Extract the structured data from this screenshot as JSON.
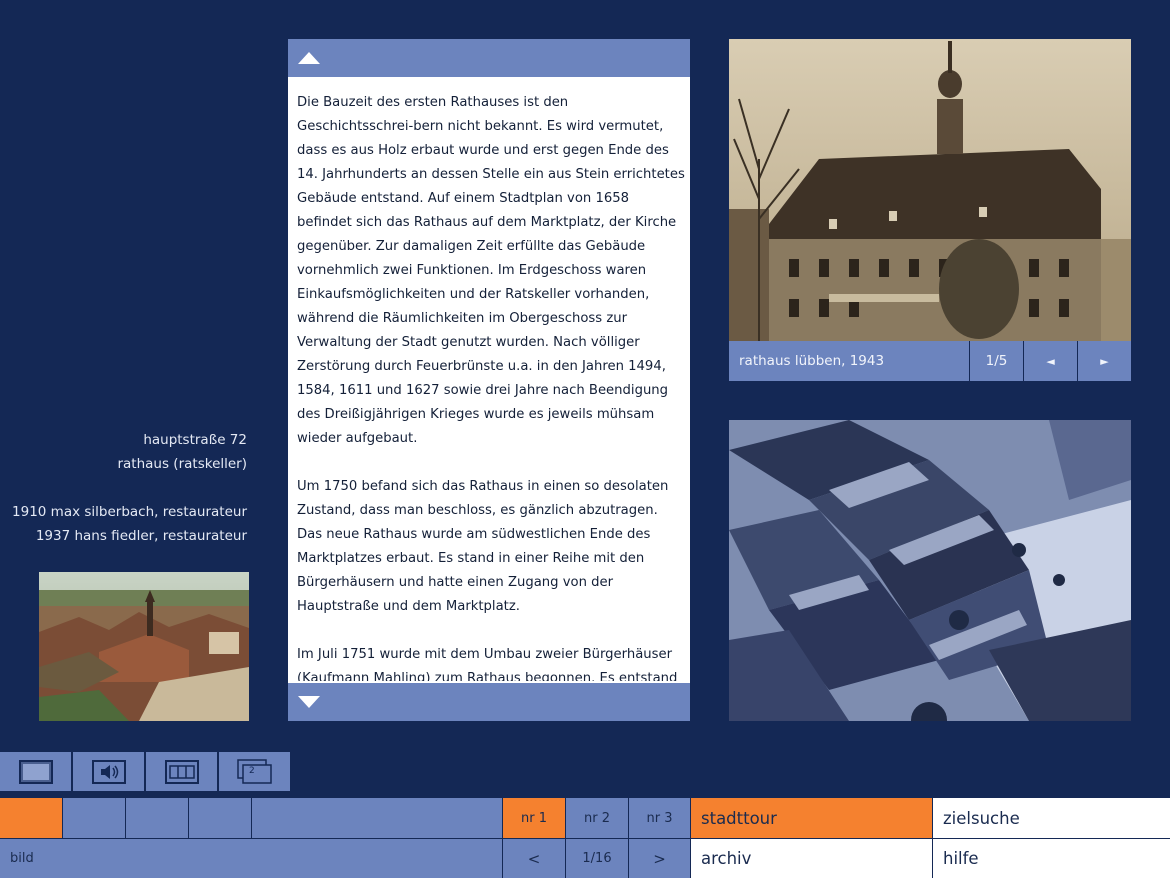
{
  "left_info": {
    "address": "hauptstraße 72",
    "building": "rathaus (ratskeller)",
    "history_1": "1910  max silberbach, restaurateur",
    "history_2": "1937 hans fiedler, restaurateur"
  },
  "text_panel": {
    "paragraphs": [
      "Die Bauzeit des ersten Rathauses ist den Geschichtsschrei-bern nicht bekannt. Es wird vermutet, dass es aus Holz erbaut wurde und erst gegen Ende des 14. Jahrhunderts an dessen Stelle ein aus Stein errichtetes Gebäude entstand. Auf einem Stadtplan von 1658 befindet sich  das Rathaus auf dem Marktplatz, der Kirche gegenüber.  Zur damaligen Zeit erfüllte das Gebäude vornehmlich zwei Funktionen. Im Erdgeschoss waren Einkaufsmöglichkeiten und der Ratskeller vorhanden, während die Räumlichkeiten im Obergeschoss zur Verwaltung der Stadt genutzt wurden. Nach völliger Zerstörung durch Feuerbrünste u.a. in den Jahren 1494, 1584, 1611 und 1627 sowie drei Jahre nach Beendigung des  Dreißigjährigen Krieges wurde es jeweils mühsam wieder aufgebaut.",
      "Um 1750 befand sich das Rathaus in einen so desolaten Zustand, dass man beschloss, es gänzlich abzutragen. Das neue Rathaus wurde am südwestlichen Ende des Marktplatzes erbaut. Es stand in einer Reihe mit den Bürgerhäusern und hatte einen Zugang von der Hauptstraße und dem Marktplatz.",
      "Im Juli 1751 wurde mit dem Umbau zweier Bürgerhäuser (Kaufmann Mahling) zum Rathaus begonnen. Es entstand"
    ]
  },
  "photo_caption": {
    "title": "rathaus lübben, 1943",
    "counter": "1/5",
    "prev": "◄",
    "next": "►"
  },
  "media_buttons": {
    "badge": "2"
  },
  "bottom_nav": {
    "bild_label": "bild",
    "nr1": "nr 1",
    "nr2": "nr 2",
    "nr3": "nr 3",
    "prev": "<",
    "page": "1/16",
    "next": ">",
    "stadttour": "stadttour",
    "zielsuche": "zielsuche",
    "archiv": "archiv",
    "hilfe": "hilfe"
  },
  "colors": {
    "background": "#142855",
    "panel_blue": "#6c84be",
    "accent_orange": "#f5812f"
  }
}
